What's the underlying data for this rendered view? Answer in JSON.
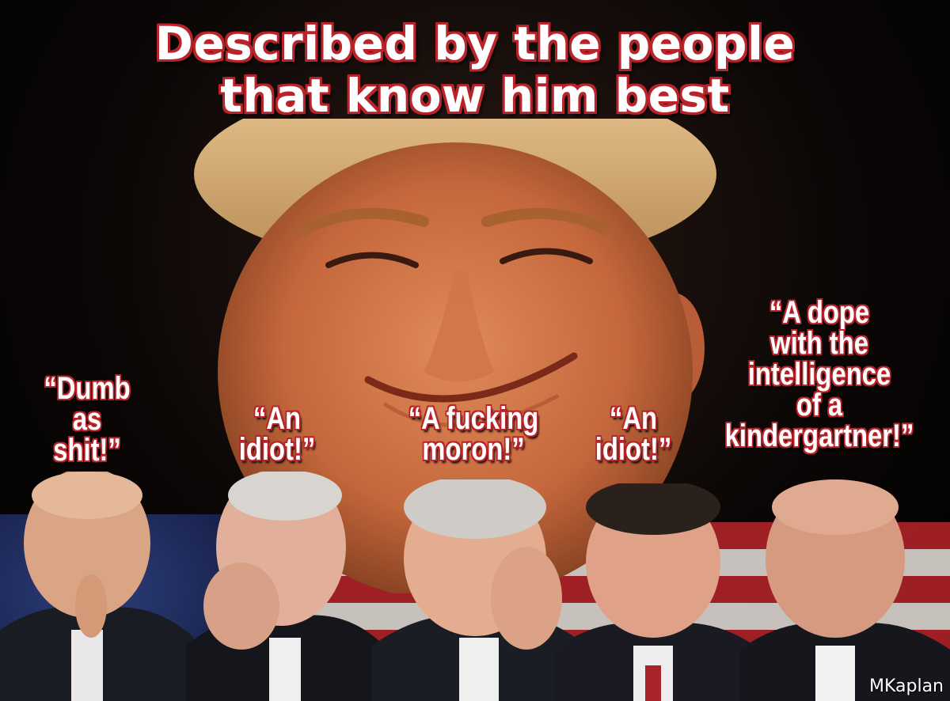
{
  "title": {
    "line1": "Described by the people",
    "line2": "that know him best"
  },
  "quotes": [
    {
      "lines": [
        "“Dumb",
        "as",
        "shit!”"
      ]
    },
    {
      "lines": [
        "“An",
        "idiot!”"
      ]
    },
    {
      "lines": [
        "“A fucking",
        "moron!”"
      ]
    },
    {
      "lines": [
        "“An",
        "idiot!”"
      ]
    },
    {
      "lines": [
        "“A dope",
        "with the",
        "intelligence",
        "of a",
        "kindergartner!”"
      ]
    }
  ],
  "watermark": "MKaplan",
  "colors": {
    "text_outline": "#b8242a",
    "text_fill": "#ffffff",
    "background": "#000000"
  }
}
